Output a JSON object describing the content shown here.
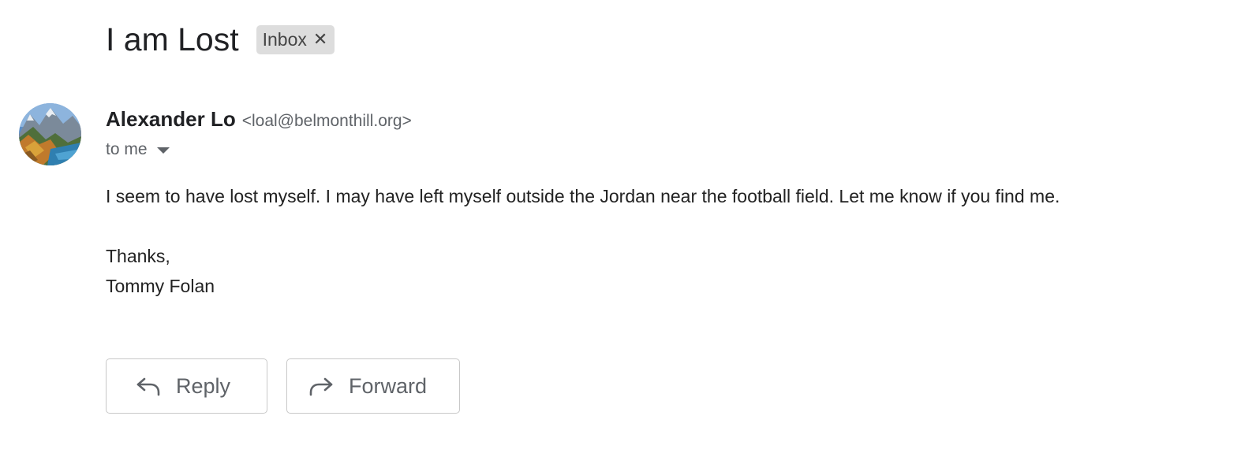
{
  "email": {
    "subject": "I am Lost",
    "label": "Inbox",
    "label_close_icon": "close-icon",
    "sender": {
      "name": "Alexander Lo",
      "email": "<loal@belmonthill.org>",
      "avatar_icon": "landscape-avatar"
    },
    "recipient_text": "to me",
    "recipient_caret_icon": "caret-down-icon",
    "body": {
      "paragraph": "I seem to have lost myself. I may have left myself outside the Jordan near the football field. Let me know if you find me.",
      "closing": "Thanks,",
      "signature": "Tommy Folan"
    }
  },
  "actions": {
    "reply_label": "Reply",
    "reply_icon": "reply-arrow-icon",
    "forward_label": "Forward",
    "forward_icon": "forward-arrow-icon"
  },
  "colors": {
    "chip_background": "#dddddd",
    "secondary_text": "#5f6368",
    "button_border": "#c8c8c8"
  }
}
